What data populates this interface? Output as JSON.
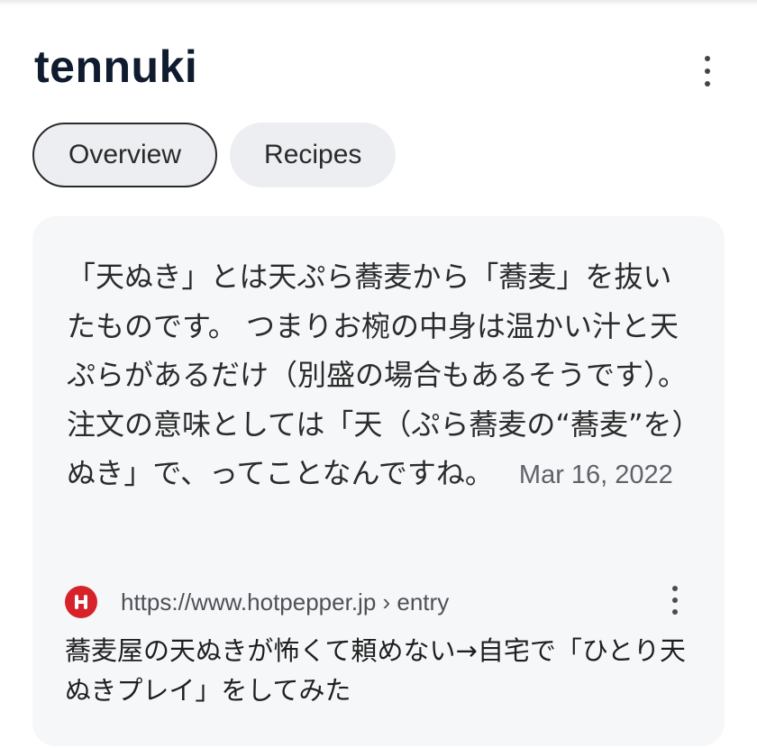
{
  "header": {
    "title": "tennuki",
    "more_icon": "more-vert-icon"
  },
  "tabs": [
    {
      "label": "Overview",
      "active": true
    },
    {
      "label": "Recipes",
      "active": false
    }
  ],
  "snippet": {
    "text": "「天ぬき」とは天ぷら蕎麦から「蕎麦」を抜いたものです。 つまりお椀の中身は温かい汁と天ぷらがあるだけ（別盛の場合もあるそうです）。 注文の意味としては「天（ぷら蕎麦の“蕎麦”を）ぬき」で、ってことなんですね。",
    "date": "Mar 16, 2022"
  },
  "source": {
    "favicon": "hotpepper-favicon-icon",
    "url": "https://www.hotpepper.jp › entry",
    "more_icon": "more-vert-icon"
  },
  "result": {
    "title": "蕎麦屋の天ぬきが怖くて頼めない→自宅で「ひとり天ぬきプレイ」をしてみた"
  },
  "colors": {
    "card_bg": "#f6f7f9",
    "tab_bg": "#eceef1",
    "favicon_red": "#d8222a",
    "title_text": "#0f1b2e"
  }
}
